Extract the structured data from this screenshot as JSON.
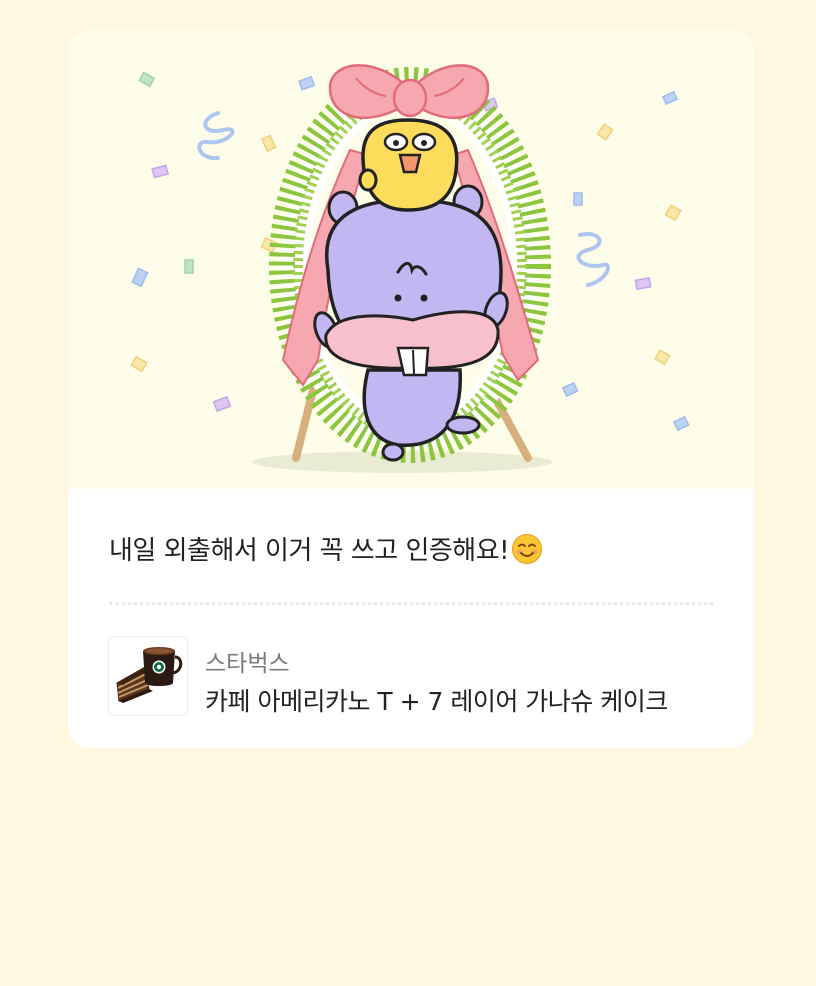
{
  "gift_card": {
    "illustration": "celebration-character-with-wreath",
    "message": "내일 외출해서 이거 꼭 쓰고 인증해요!",
    "message_emoji": "smiling-face-icon",
    "product": {
      "brand": "스타벅스",
      "name": "카페 아메리카노 T + 7 레이어 가나슈 케이크",
      "thumbnail": "coffee-and-cake-image"
    }
  },
  "colors": {
    "page_background": "#fef8e1",
    "hero_background": "#fdfde9",
    "card_background": "#ffffff",
    "character_purple": "#c2b6f3",
    "ribbon_pink": "#f7a7b0",
    "wreath_green": "#8cc63f"
  }
}
